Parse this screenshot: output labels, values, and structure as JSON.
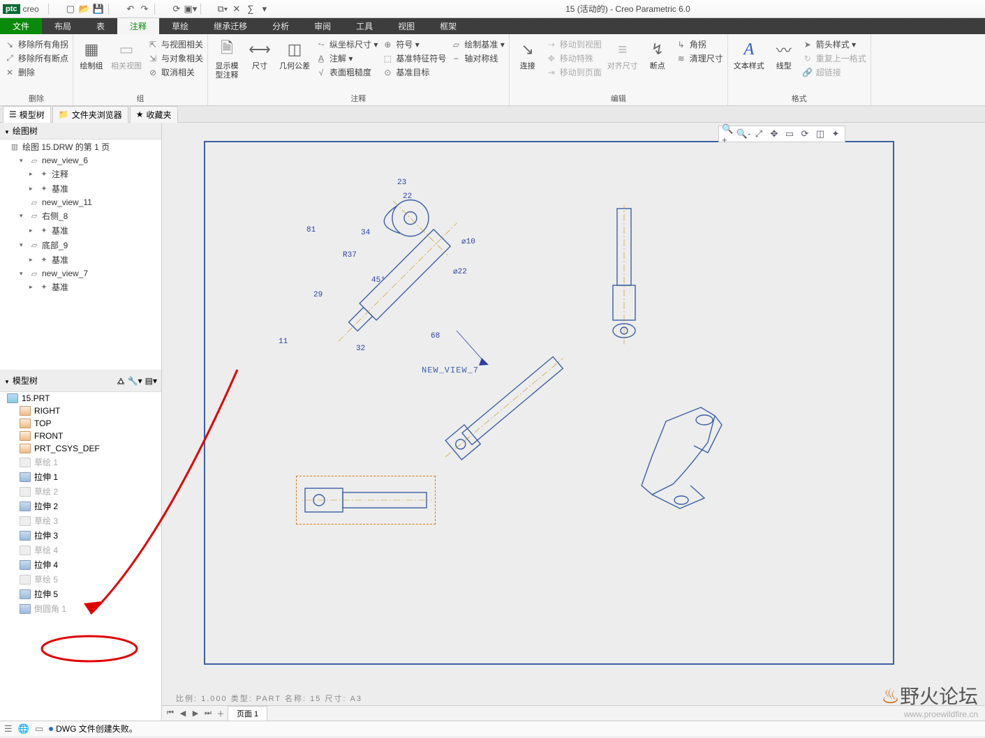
{
  "title_bar": {
    "app_badge": "ptc",
    "app_name": "creo",
    "document_title": "15 (活动的) - Creo Parametric 6.0",
    "active_marker": "15"
  },
  "menu": {
    "file": "文件",
    "tabs": [
      "布局",
      "表",
      "注释",
      "草绘",
      "继承迁移",
      "分析",
      "审阅",
      "工具",
      "视图",
      "框架"
    ],
    "active_index": 2
  },
  "ribbon": {
    "groups": [
      {
        "label": "删除",
        "items": [
          {
            "t": "移除所有角拐",
            "k": "row"
          },
          {
            "t": "移除所有断点",
            "k": "row"
          },
          {
            "t": "删除",
            "k": "row"
          }
        ]
      },
      {
        "label": "组",
        "items": [
          {
            "t": "绘制组",
            "k": "big"
          },
          {
            "t": "相关视图",
            "k": "big-dis"
          },
          {
            "t": "与视图相关",
            "k": "row"
          },
          {
            "t": "与对象相关",
            "k": "row"
          },
          {
            "t": "取消相关",
            "k": "row"
          }
        ]
      },
      {
        "label": "注释",
        "items": [
          {
            "t": "显示模型注释",
            "k": "big"
          },
          {
            "t": "尺寸",
            "k": "big"
          },
          {
            "t": "几何公差",
            "k": "big"
          },
          {
            "t": "纵坐标尺寸 ▾",
            "k": "row"
          },
          {
            "t": "注解 ▾",
            "k": "row"
          },
          {
            "t": "表面粗糙度",
            "k": "row"
          },
          {
            "t": "符号 ▾",
            "k": "row"
          },
          {
            "t": "基准特征符号",
            "k": "row"
          },
          {
            "t": "基准目标",
            "k": "row"
          },
          {
            "t": "绘制基准 ▾",
            "k": "row"
          },
          {
            "t": "轴对称线",
            "k": "row"
          }
        ]
      },
      {
        "label": "编辑",
        "items": [
          {
            "t": "连接",
            "k": "big"
          },
          {
            "t": "移动到视图",
            "k": "row-dis"
          },
          {
            "t": "移动特殊",
            "k": "row-dis"
          },
          {
            "t": "移动到页面",
            "k": "row-dis"
          },
          {
            "t": "对齐尺寸",
            "k": "big-dis"
          },
          {
            "t": "断点",
            "k": "big"
          },
          {
            "t": "角拐",
            "k": "row"
          },
          {
            "t": "清理尺寸",
            "k": "row"
          }
        ]
      },
      {
        "label": "格式",
        "items": [
          {
            "t": "文本样式",
            "k": "big"
          },
          {
            "t": "线型",
            "k": "big"
          },
          {
            "t": "箭头样式 ▾",
            "k": "row"
          },
          {
            "t": "重复上一格式",
            "k": "row-dis"
          },
          {
            "t": "超链接",
            "k": "row-dis"
          }
        ]
      }
    ]
  },
  "browser_tabs": [
    {
      "label": "模型树",
      "active": true
    },
    {
      "label": "文件夹浏览器",
      "active": false
    },
    {
      "label": "收藏夹",
      "active": false
    }
  ],
  "draw_tree": {
    "header": "绘图树",
    "root": "绘图 15.DRW 的第 1 页",
    "nodes": [
      {
        "name": "new_view_6",
        "children": [
          "注释",
          "基准"
        ]
      },
      {
        "name": "new_view_11",
        "children": []
      },
      {
        "name": "右侧_8",
        "children": [
          "基准"
        ]
      },
      {
        "name": "底部_9",
        "children": [
          "基准"
        ]
      },
      {
        "name": "new_view_7",
        "children": [
          "基准"
        ]
      }
    ]
  },
  "model_tree": {
    "header": "模型树",
    "root": "15.PRT",
    "items": [
      {
        "name": "RIGHT",
        "type": "datum"
      },
      {
        "name": "TOP",
        "type": "datum"
      },
      {
        "name": "FRONT",
        "type": "datum"
      },
      {
        "name": "PRT_CSYS_DEF",
        "type": "csys"
      },
      {
        "name": "草绘 1",
        "type": "sketch",
        "dim": true
      },
      {
        "name": "拉伸 1",
        "type": "feat"
      },
      {
        "name": "草绘 2",
        "type": "sketch",
        "dim": true
      },
      {
        "name": "拉伸 2",
        "type": "feat"
      },
      {
        "name": "草绘 3",
        "type": "sketch",
        "dim": true
      },
      {
        "name": "拉伸 3",
        "type": "feat"
      },
      {
        "name": "草绘 4",
        "type": "sketch",
        "dim": true
      },
      {
        "name": "拉伸 4",
        "type": "feat"
      },
      {
        "name": "草绘 5",
        "type": "sketch",
        "dim": true
      },
      {
        "name": "拉伸 5",
        "type": "feat"
      },
      {
        "name": "倒圆角 1",
        "type": "feat",
        "dim": true
      }
    ]
  },
  "dimensions": {
    "d23": "23",
    "d22": "22",
    "d34": "34",
    "d81": "81",
    "dR37": "R37",
    "d45": "45°",
    "dPhi10": "⌀10",
    "dPhi22": "⌀22",
    "d29": "29",
    "d11": "11",
    "d32": "32",
    "d68": "68"
  },
  "view_label": "NEW_VIEW_7",
  "info_bar": "比例:  1.000    类型:  PART    名称:  15   尺寸:  A3",
  "sheet_tab": "页面 1",
  "status_message": "DWG 文件创建失败。",
  "watermark": {
    "text": "野火论坛",
    "url": "www.proewildfire.cn"
  }
}
